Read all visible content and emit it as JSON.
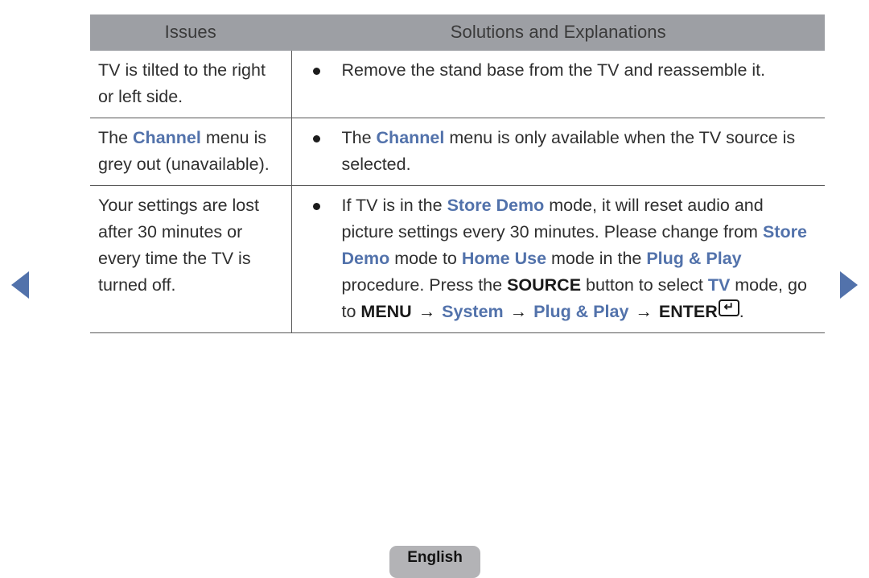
{
  "page": {
    "language_badge": "English"
  },
  "nav": {
    "prev_label": "◀",
    "next_label": "▶",
    "accent_color": "#5272ab"
  },
  "table": {
    "headers": {
      "issues": "Issues",
      "solutions": "Solutions and Explanations"
    },
    "rows": [
      {
        "issue": "TV is tilted to the right or left side.",
        "solutions": [
          "Remove the stand base from the TV and reassemble it."
        ]
      },
      {
        "issue_parts": [
          {
            "text": "The ",
            "style": "plain"
          },
          {
            "text": "Channel",
            "style": "blue-bold"
          },
          {
            "text": " menu is grey out (unavailable).",
            "style": "plain"
          }
        ],
        "solution_parts": [
          {
            "text": "The ",
            "style": "plain"
          },
          {
            "text": "Channel",
            "style": "blue-bold"
          },
          {
            "text": " menu is only available when the TV source is selected.",
            "style": "plain"
          }
        ]
      },
      {
        "issue": "Your settings are lost after 30 minutes or every time the TV is turned off.",
        "solution_parts": [
          {
            "text": "If TV is in the ",
            "style": "plain"
          },
          {
            "text": "Store Demo",
            "style": "blue-bold"
          },
          {
            "text": " mode, it will reset audio and picture settings every 30 minutes. Please change from ",
            "style": "plain"
          },
          {
            "text": "Store Demo",
            "style": "blue-bold"
          },
          {
            "text": " mode to ",
            "style": "plain"
          },
          {
            "text": "Home Use",
            "style": "blue-bold"
          },
          {
            "text": " mode in the ",
            "style": "plain"
          },
          {
            "text": "Plug & Play",
            "style": "blue-bold"
          },
          {
            "text": " procedure. Press the ",
            "style": "plain"
          },
          {
            "text": "SOURCE",
            "style": "black-bold"
          },
          {
            "text": " button to select ",
            "style": "plain"
          },
          {
            "text": "TV",
            "style": "blue-bold"
          },
          {
            "text": " mode, go to ",
            "style": "plain"
          },
          {
            "text": "MENU",
            "style": "black-bold"
          },
          {
            "text": " → ",
            "style": "arrow"
          },
          {
            "text": "System",
            "style": "blue-bold"
          },
          {
            "text": " → ",
            "style": "arrow"
          },
          {
            "text": "Plug & Play",
            "style": "blue-bold"
          },
          {
            "text": " → ",
            "style": "arrow"
          },
          {
            "text": "ENTER",
            "style": "black-bold"
          },
          {
            "text": "↵",
            "style": "enter-key"
          },
          {
            "text": ".",
            "style": "plain"
          }
        ]
      }
    ]
  }
}
